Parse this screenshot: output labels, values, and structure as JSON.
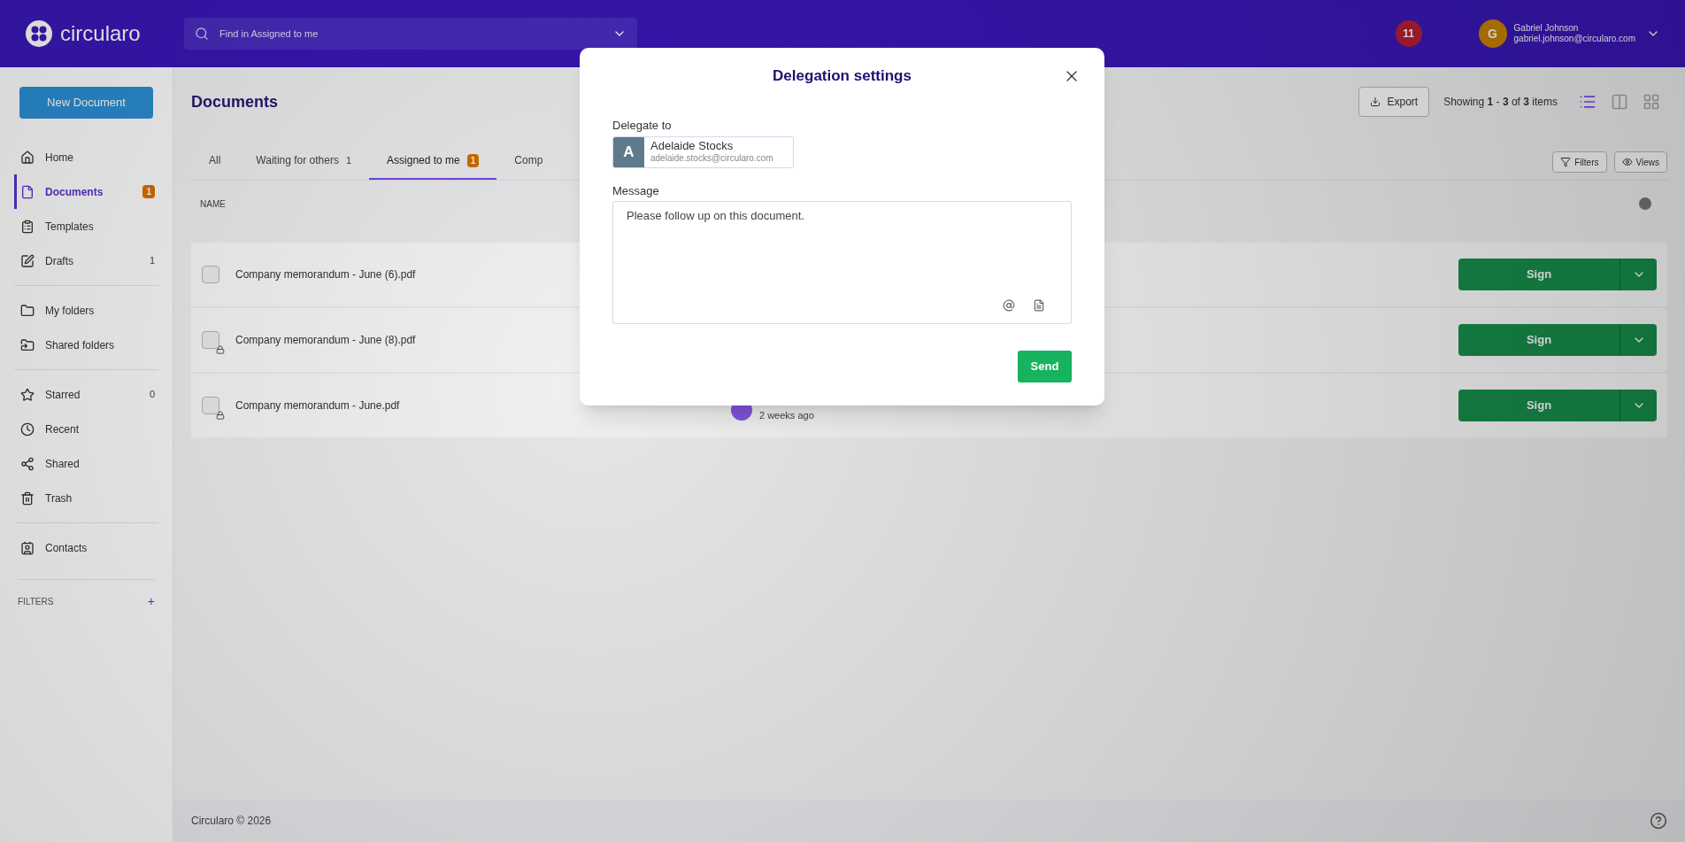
{
  "topbar": {
    "logo": "circularo",
    "search": {
      "placeholder": "Find in Assigned to me"
    },
    "notifications": "11",
    "user": {
      "initial": "G",
      "name": "Gabriel Johnson",
      "email": "gabriel.johnson@circularo.com"
    }
  },
  "sidebar": {
    "new_button": "New Document",
    "groups": [
      [
        {
          "label": "Home",
          "selected": false
        },
        {
          "label": "Documents",
          "badge": "1",
          "selected": true
        },
        {
          "label": "Templates",
          "selected": false
        },
        {
          "label": "Drafts",
          "count": "1",
          "selected": false
        }
      ],
      [
        {
          "label": "My folders",
          "selected": false
        },
        {
          "label": "Shared folders",
          "selected": false
        }
      ],
      [
        {
          "label": "Starred",
          "count": "0",
          "selected": false
        },
        {
          "label": "Recent",
          "selected": false
        },
        {
          "label": "Shared",
          "selected": false
        },
        {
          "label": "Trash",
          "selected": false
        }
      ],
      [
        {
          "label": "Contacts",
          "selected": false
        }
      ]
    ],
    "filters_label": "FILTERS",
    "filters_add": "+"
  },
  "main": {
    "title": "Documents",
    "export": "Export",
    "showing": "Showing **1** - **3** of **3** items",
    "views": [
      {
        "selected": true
      },
      {
        "selected": false
      },
      {
        "selected": false
      }
    ],
    "tabs": [
      {
        "label": "All",
        "selected": false
      },
      {
        "label": "Waiting for others",
        "count": "1",
        "selected": false
      },
      {
        "label": "Assigned to me",
        "badge": "1",
        "selected": true
      },
      {
        "label": "Comp",
        "selected": false
      }
    ],
    "filters": "Filters",
    "views_button": "Views",
    "column_name": "NAME",
    "rows": [
      {
        "name": "Company memorandum - June (6).pdf",
        "checked": false,
        "locked": false,
        "sign": "Sign"
      },
      {
        "name": "Company memorandum - June (8).pdf",
        "checked": false,
        "locked": true,
        "sign": "Sign"
      },
      {
        "name": "Company memorandum - June.pdf",
        "checked": false,
        "locked": true,
        "updated": "2 weeks ago",
        "sign": "Sign"
      }
    ],
    "footer": "Circularo © 2026"
  },
  "dialog": {
    "title": "Delegation settings",
    "delegate_label": "Delegate to",
    "delegate": {
      "initial": "A",
      "name": "Adelaide Stocks",
      "email": "adelaide.stocks@circularo.com"
    },
    "message_label": "Message",
    "message": "Please follow up on this document.",
    "send": "Send"
  }
}
